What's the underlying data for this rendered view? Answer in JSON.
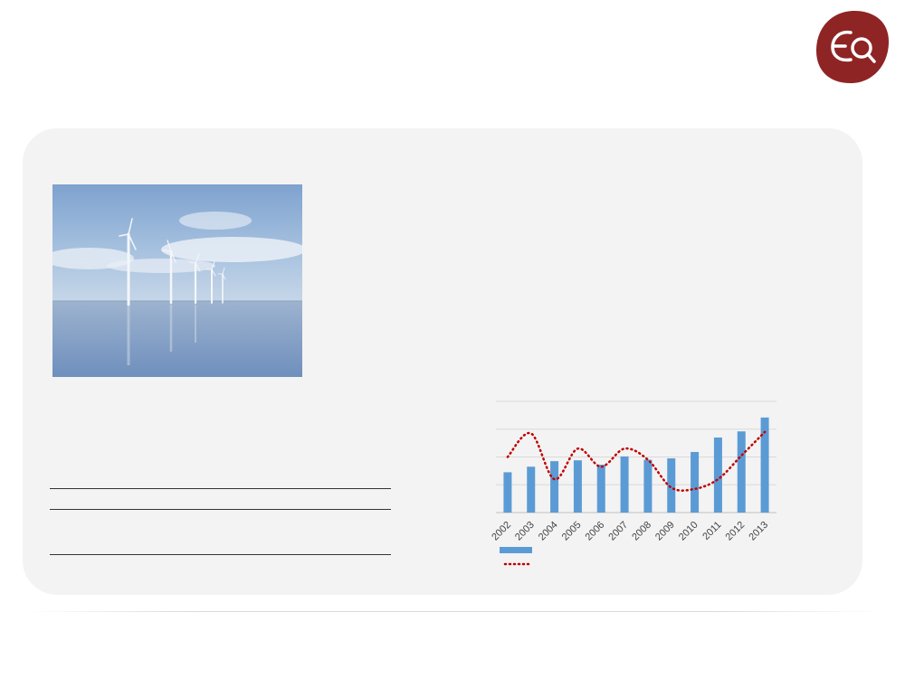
{
  "logo": {
    "icon": "eq-logo-icon",
    "color": "#8f2424"
  },
  "photo": {
    "icon": "offshore-wind-turbines-photo"
  },
  "chart_data": {
    "type": "bar",
    "categories": [
      "2002",
      "2003",
      "2004",
      "2005",
      "2006",
      "2007",
      "2008",
      "2009",
      "2010",
      "2011",
      "2012",
      "2013"
    ],
    "ylim": [
      0,
      4
    ],
    "grid": true,
    "legend": "bottom-left",
    "series": [
      {
        "type": "bar",
        "color": "#5b9bd5",
        "values": [
          1.45,
          1.65,
          1.85,
          1.88,
          1.72,
          2.02,
          1.9,
          1.95,
          2.18,
          2.7,
          2.92,
          3.42
        ]
      },
      {
        "type": "line",
        "style": "dotted",
        "color": "#c00000",
        "values": [
          2.0,
          2.85,
          1.2,
          2.3,
          1.65,
          2.3,
          1.9,
          0.9,
          0.85,
          1.2,
          2.05,
          2.9
        ]
      }
    ]
  }
}
